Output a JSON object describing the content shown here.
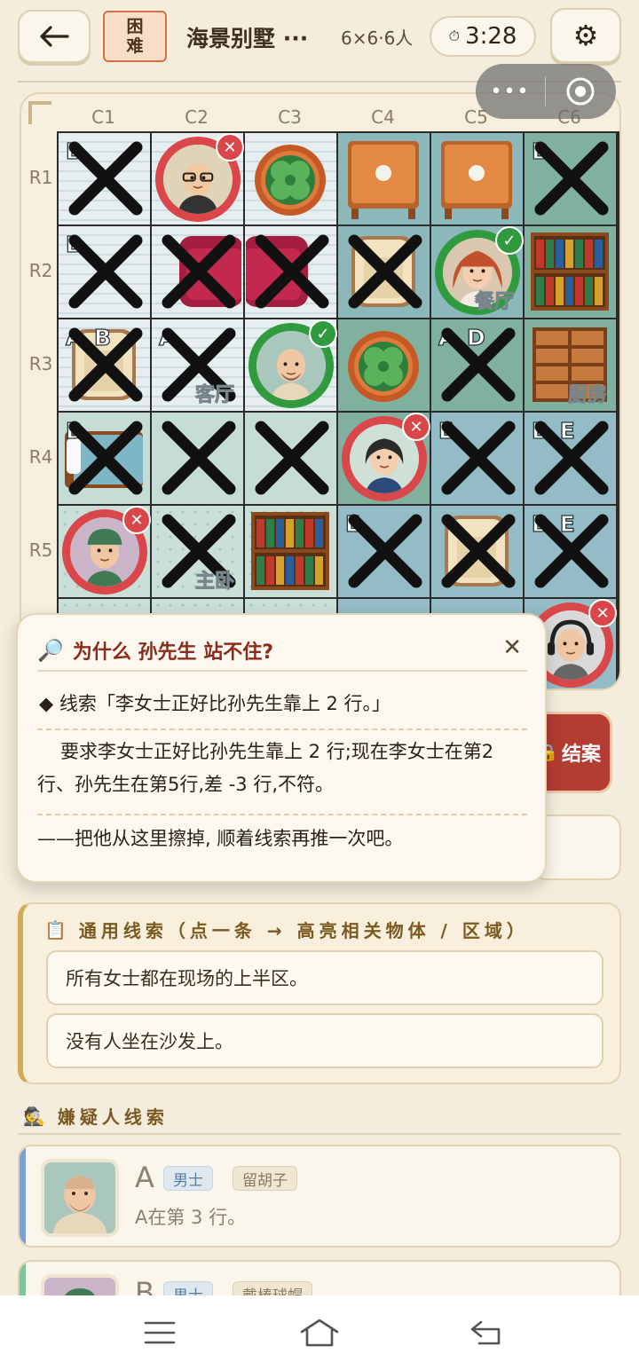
{
  "header": {
    "difficulty": "困难",
    "title": "海景别墅 ···",
    "meta": "6×6·6人",
    "timer": "3:28"
  },
  "board": {
    "columns": [
      "C1",
      "C2",
      "C3",
      "C4",
      "C5",
      "C6"
    ],
    "rows": [
      "R1",
      "R2",
      "R3",
      "R4",
      "R5"
    ],
    "rooms": {
      "dining": "餐厅",
      "living": "客厅",
      "kitchen": "厨房",
      "bedroom": "主卧"
    },
    "cells": [
      {
        "r": 0,
        "c": 0,
        "floor": "wood",
        "mark": "B",
        "x": true
      },
      {
        "r": 0,
        "c": 1,
        "floor": "wood",
        "avatar": "glasses-man",
        "status": "bad"
      },
      {
        "r": 0,
        "c": 2,
        "floor": "wood",
        "item": "plant"
      },
      {
        "r": 0,
        "c": 3,
        "floor": "teal",
        "item": "table"
      },
      {
        "r": 0,
        "c": 4,
        "floor": "teal",
        "item": "table"
      },
      {
        "r": 0,
        "c": 5,
        "floor": "green",
        "mark": "B",
        "x": true
      },
      {
        "r": 1,
        "c": 0,
        "floor": "wood",
        "mark": "B",
        "x": true
      },
      {
        "r": 1,
        "c": 1,
        "floor": "wood",
        "item": "sofa-left",
        "x": true
      },
      {
        "r": 1,
        "c": 2,
        "floor": "wood",
        "item": "sofa-right",
        "x": true
      },
      {
        "r": 1,
        "c": 3,
        "floor": "teal",
        "item": "chair",
        "x": true
      },
      {
        "r": 1,
        "c": 4,
        "floor": "teal",
        "avatar": "red-hair-woman",
        "status": "good",
        "room": "dining"
      },
      {
        "r": 1,
        "c": 5,
        "floor": "green",
        "item": "bookshelf"
      },
      {
        "r": 2,
        "c": 0,
        "floor": "wood",
        "mark": "A B",
        "item": "chair",
        "x": true
      },
      {
        "r": 2,
        "c": 1,
        "floor": "wood",
        "mark": "A",
        "x": true,
        "room": "living"
      },
      {
        "r": 2,
        "c": 2,
        "floor": "wood",
        "avatar": "bald-man",
        "status": "good"
      },
      {
        "r": 2,
        "c": 3,
        "floor": "green",
        "item": "plant"
      },
      {
        "r": 2,
        "c": 4,
        "floor": "green",
        "mark": "A D",
        "x": true
      },
      {
        "r": 2,
        "c": 5,
        "floor": "green",
        "item": "crate",
        "room": "kitchen"
      },
      {
        "r": 3,
        "c": 0,
        "floor": "sage",
        "mark": "B",
        "item": "bed",
        "x": true
      },
      {
        "r": 3,
        "c": 1,
        "floor": "sage",
        "x": true
      },
      {
        "r": 3,
        "c": 2,
        "floor": "sage",
        "x": true
      },
      {
        "r": 3,
        "c": 3,
        "floor": "green",
        "avatar": "girl",
        "status": "bad"
      },
      {
        "r": 3,
        "c": 4,
        "floor": "grass",
        "mark": "E",
        "x": true
      },
      {
        "r": 3,
        "c": 5,
        "floor": "grass",
        "mark": "B E",
        "x": true
      },
      {
        "r": 4,
        "c": 0,
        "floor": "dot",
        "avatar": "cap-man",
        "status": "bad"
      },
      {
        "r": 4,
        "c": 1,
        "floor": "dot",
        "x": true,
        "room": "bedroom"
      },
      {
        "r": 4,
        "c": 2,
        "floor": "dot",
        "item": "bookshelf"
      },
      {
        "r": 4,
        "c": 3,
        "floor": "grass",
        "mark": "E",
        "x": true
      },
      {
        "r": 4,
        "c": 4,
        "floor": "grass",
        "item": "chair",
        "x": true
      },
      {
        "r": 4,
        "c": 5,
        "floor": "grass",
        "mark": "B E",
        "x": true
      }
    ],
    "partial_row_avatar": "headphone-man"
  },
  "popup": {
    "icon": "magnifier-icon",
    "title": "为什么 孙先生 站不住?",
    "clue": "◆ 线索「李女士正好比孙先生靠上 2 行。」",
    "body": "要求李女士正好比孙先生靠上 2 行;现在李女士在第2行、孙先生在第5行,差 -3 行,不符。",
    "footer": "——把他从这里擦掉, 顺着线索再推一次吧。"
  },
  "actions": {
    "case_button": "结案"
  },
  "general_clues": {
    "title": "通用线索（点一条 → 高亮相关物体 / 区域）",
    "items": [
      "所有女士都在现场的上半区。",
      "没有人坐在沙发上。"
    ]
  },
  "suspect_clues": {
    "title": "嫌疑人线索",
    "cards": [
      {
        "letter": "A",
        "gender": "男士",
        "trait": "留胡子",
        "desc": "A在第 3 行。",
        "accent": "#7f9fd4"
      },
      {
        "letter": "B",
        "gender": "男士",
        "trait": "戴棒球帽",
        "desc": "",
        "accent": "#7fc49a"
      }
    ]
  },
  "colors": {
    "accent": "#b43c32",
    "good": "#2f9a3e",
    "bad": "#d9474a"
  }
}
